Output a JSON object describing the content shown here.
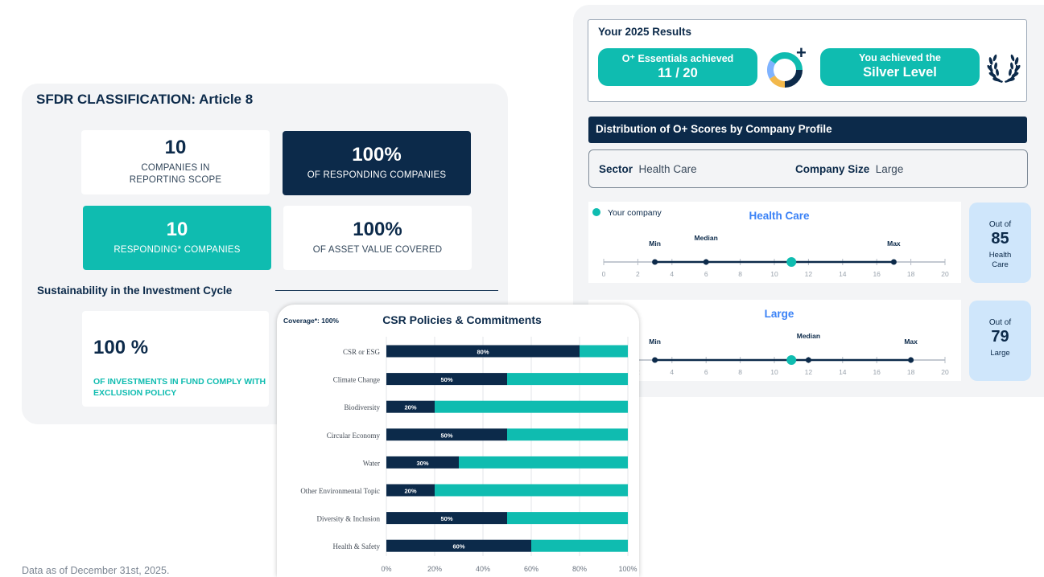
{
  "sfdr": {
    "title": "SFDR CLASSIFICATION: Article 8",
    "cards": [
      {
        "value": "10",
        "label": "COMPANIES IN\nREPORTING SCOPE"
      },
      {
        "value": "100%",
        "label": "OF RESPONDING COMPANIES"
      },
      {
        "value": "10",
        "label": "RESPONDING* COMPANIES"
      },
      {
        "value": "100%",
        "label": "OF ASSET VALUE COVERED"
      }
    ],
    "cycle_title": "Sustainability in the Investment Cycle",
    "exclusion": {
      "value": "100 %",
      "label": "OF INVESTMENTS IN FUND COMPLY WITH EXCLUSION POLICY"
    }
  },
  "results": {
    "title": "Your 2025 Results",
    "essentials_label": "O⁺ Essentials achieved",
    "essentials_value": "11 / 20",
    "plus_sign": "+",
    "level_label": "You achieved the",
    "level_value": "Silver Level"
  },
  "distribution": {
    "title": "Distribution of O+ Scores by Company Profile",
    "sector_label": "Sector",
    "sector_value": "Health Care",
    "size_label": "Company Size",
    "size_value": "Large",
    "legend": "Your company",
    "axis_ticks": [
      "0",
      "2",
      "4",
      "6",
      "8",
      "10",
      "12",
      "14",
      "16",
      "18",
      "20"
    ],
    "ranges": [
      {
        "title": "Health Care",
        "min": 3,
        "median": 6,
        "max": 17,
        "company": 11,
        "min_label": "Min",
        "median_label": "Median",
        "max_label": "Max",
        "outof_label": "Out of",
        "outof_value": "85",
        "outof_caption": "Health\nCare"
      },
      {
        "title": "Large",
        "min": 3,
        "median": 12,
        "max": 18,
        "company": 11,
        "min_label": "Min",
        "median_label": "Median",
        "max_label": "Max",
        "outof_label": "Out of",
        "outof_value": "79",
        "outof_caption": "Large"
      }
    ]
  },
  "chart_data": {
    "type": "bar",
    "title": "CSR Policies & Commitments",
    "coverage_label": "Coverage*:  100%",
    "categories": [
      "CSR or ESG",
      "Climate Change",
      "Biodiversity",
      "Circular Economy",
      "Water",
      "Other Environmental Topic",
      "Diversity & Inclusion",
      "Health & Safety"
    ],
    "values": [
      80,
      50,
      20,
      50,
      30,
      20,
      50,
      60
    ],
    "data_labels": [
      "80%",
      "50%",
      "20%",
      "50%",
      "30%",
      "20%",
      "50%",
      "60%"
    ],
    "stacked_remainder": true,
    "xlim": [
      0,
      100
    ],
    "x_ticks": [
      "0%",
      "20%",
      "40%",
      "60%",
      "80%",
      "100%"
    ],
    "colors": {
      "value": "#0c2a4a",
      "remainder": "#0fbcb0"
    },
    "grid": true
  },
  "footer": {
    "note": "Data as of December 31st, 2025."
  },
  "colors": {
    "navy": "#0c2a4a",
    "teal": "#0fbcb0",
    "light_blue": "#cfe6fb",
    "accent_blue": "#3b82f6",
    "panel_gray": "#f3f4f6"
  }
}
